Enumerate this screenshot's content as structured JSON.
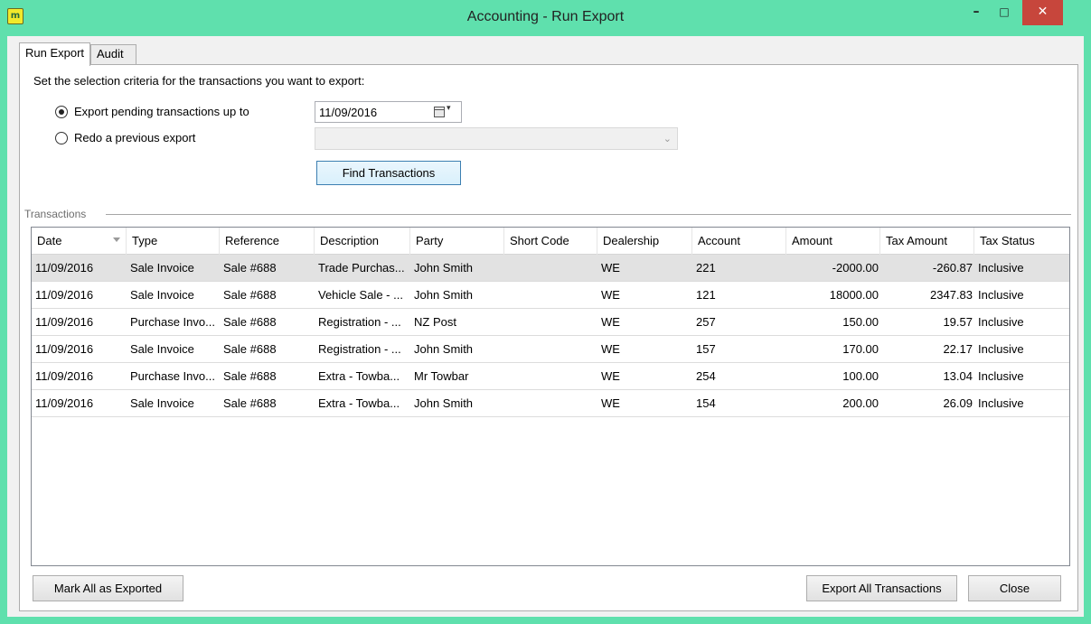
{
  "window": {
    "title": "Accounting - Run Export",
    "app_icon_letter": "m",
    "minimize_glyph": "–",
    "maximize_glyph": "□",
    "close_glyph": "✕"
  },
  "tabs": [
    {
      "label": "Run Export",
      "active": true
    },
    {
      "label": "Audit",
      "active": false
    }
  ],
  "criteria": {
    "instruction": "Set the selection criteria for the transactions you want to export:",
    "option_pending_label": "Export pending transactions up to",
    "option_pending_checked": true,
    "option_redo_label": "Redo a previous export",
    "option_redo_checked": false,
    "date_value": "11/09/2016",
    "date_dropdown_glyph": "▾",
    "previous_export_value": "",
    "combo_arrow_glyph": "⌄",
    "find_button_label": "Find Transactions"
  },
  "transactions": {
    "group_label": "Transactions",
    "columns": [
      "Date",
      "Type",
      "Reference",
      "Description",
      "Party",
      "Short Code",
      "Dealership",
      "Account",
      "Amount",
      "Tax Amount",
      "Tax Status"
    ],
    "sorted_column": "Date",
    "rows": [
      {
        "date": "11/09/2016",
        "type": "Sale Invoice",
        "reference": "Sale #688",
        "description": "Trade Purchas...",
        "party": "John Smith",
        "short_code": "",
        "dealership": "WE",
        "account": "221",
        "amount": "-2000.00",
        "tax_amount": "-260.87",
        "tax_status": "Inclusive",
        "selected": true
      },
      {
        "date": "11/09/2016",
        "type": "Sale Invoice",
        "reference": "Sale #688",
        "description": "Vehicle Sale - ...",
        "party": "John Smith",
        "short_code": "",
        "dealership": "WE",
        "account": "121",
        "amount": "18000.00",
        "tax_amount": "2347.83",
        "tax_status": "Inclusive",
        "selected": false
      },
      {
        "date": "11/09/2016",
        "type": "Purchase Invo...",
        "reference": "Sale #688",
        "description": "Registration - ...",
        "party": "NZ Post",
        "short_code": "",
        "dealership": "WE",
        "account": "257",
        "amount": "150.00",
        "tax_amount": "19.57",
        "tax_status": "Inclusive",
        "selected": false
      },
      {
        "date": "11/09/2016",
        "type": "Sale Invoice",
        "reference": "Sale #688",
        "description": "Registration - ...",
        "party": "John Smith",
        "short_code": "",
        "dealership": "WE",
        "account": "157",
        "amount": "170.00",
        "tax_amount": "22.17",
        "tax_status": "Inclusive",
        "selected": false
      },
      {
        "date": "11/09/2016",
        "type": "Purchase Invo...",
        "reference": "Sale #688",
        "description": "Extra - Towba...",
        "party": "Mr Towbar",
        "short_code": "",
        "dealership": "WE",
        "account": "254",
        "amount": "100.00",
        "tax_amount": "13.04",
        "tax_status": "Inclusive",
        "selected": false
      },
      {
        "date": "11/09/2016",
        "type": "Sale Invoice",
        "reference": "Sale #688",
        "description": "Extra - Towba...",
        "party": "John Smith",
        "short_code": "",
        "dealership": "WE",
        "account": "154",
        "amount": "200.00",
        "tax_amount": "26.09",
        "tax_status": "Inclusive",
        "selected": false
      }
    ]
  },
  "footer": {
    "mark_all_label": "Mark All as Exported",
    "export_all_label": "Export All Transactions",
    "close_label": "Close"
  },
  "colors": {
    "window_frame": "#5fe0ad",
    "close_button": "#c7463c",
    "selected_row": "#e2e2e2",
    "find_button_border": "#3c7fb1"
  }
}
